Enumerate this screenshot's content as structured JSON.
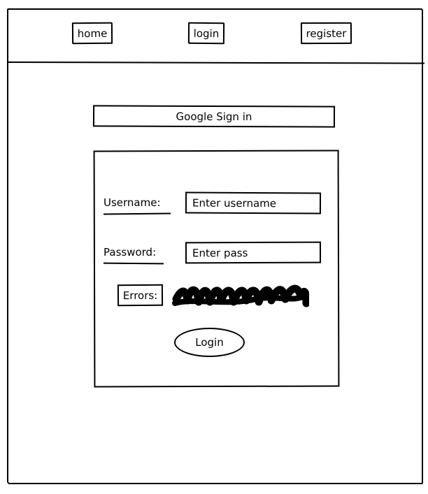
{
  "nav": {
    "home_label": "home",
    "login_label": "login",
    "register_label": "register"
  },
  "google_signin": {
    "label": "Google Sign in"
  },
  "form": {
    "username_label": "Username:",
    "username_placeholder": "Enter username",
    "password_label": "Password:",
    "password_placeholder": "Enter pass",
    "errors_label": "Errors:",
    "submit_label": "Login"
  }
}
